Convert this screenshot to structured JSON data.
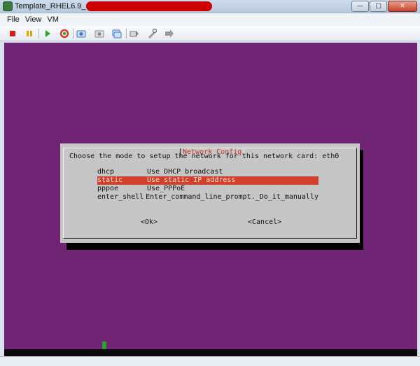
{
  "window": {
    "title": "Template_RHEL6.9_OS_x64",
    "controls": {
      "minimize": "—",
      "maximize": "□",
      "close": "✕"
    }
  },
  "menubar": {
    "items": [
      "File",
      "View",
      "VM"
    ]
  },
  "toolbar": {
    "buttons": [
      {
        "icon": "stop-icon",
        "color": "#d11f1f"
      },
      {
        "icon": "pause-icon",
        "color": "#e5a100"
      },
      {
        "icon": "play-icon",
        "color": "#2aa52a"
      },
      {
        "icon": "reset-icon",
        "color": "#d33a2a"
      },
      {
        "icon": "snapshot-icon",
        "color": "#3a78c9"
      },
      {
        "icon": "revert-snapshot-icon",
        "color": "#8a8a8a"
      },
      {
        "icon": "manage-snapshots-icon",
        "color": "#3a78c9"
      },
      {
        "icon": "send-ctrl-alt-del-icon",
        "color": "#7a7a7a"
      },
      {
        "icon": "settings-icon",
        "color": "#7a7a7a"
      },
      {
        "icon": "fullscreen-icon",
        "color": "#7a7a7a"
      }
    ]
  },
  "colors": {
    "console_background": "#6f2573",
    "dialog_background": "#c6c6c6",
    "selection": "#d1402b",
    "title_text": "#c0392b",
    "cursor": "#27a52a"
  },
  "dialog": {
    "title": "Network Config",
    "prompt": "Choose the mode to setup the network for this network card: eth0",
    "items": [
      {
        "tag": "dhcp",
        "description": "Use DHCP broadcast",
        "selected": false
      },
      {
        "tag": "static",
        "description": "Use static IP address",
        "selected": true
      },
      {
        "tag": "pppoe",
        "description": "Use_PPPoE",
        "selected": false
      },
      {
        "tag": "enter_shell",
        "description": "Enter_command_line_prompt._Do_it_manually",
        "selected": false
      }
    ],
    "ok_label": "<Ok>",
    "cancel_label": "<Cancel>"
  }
}
